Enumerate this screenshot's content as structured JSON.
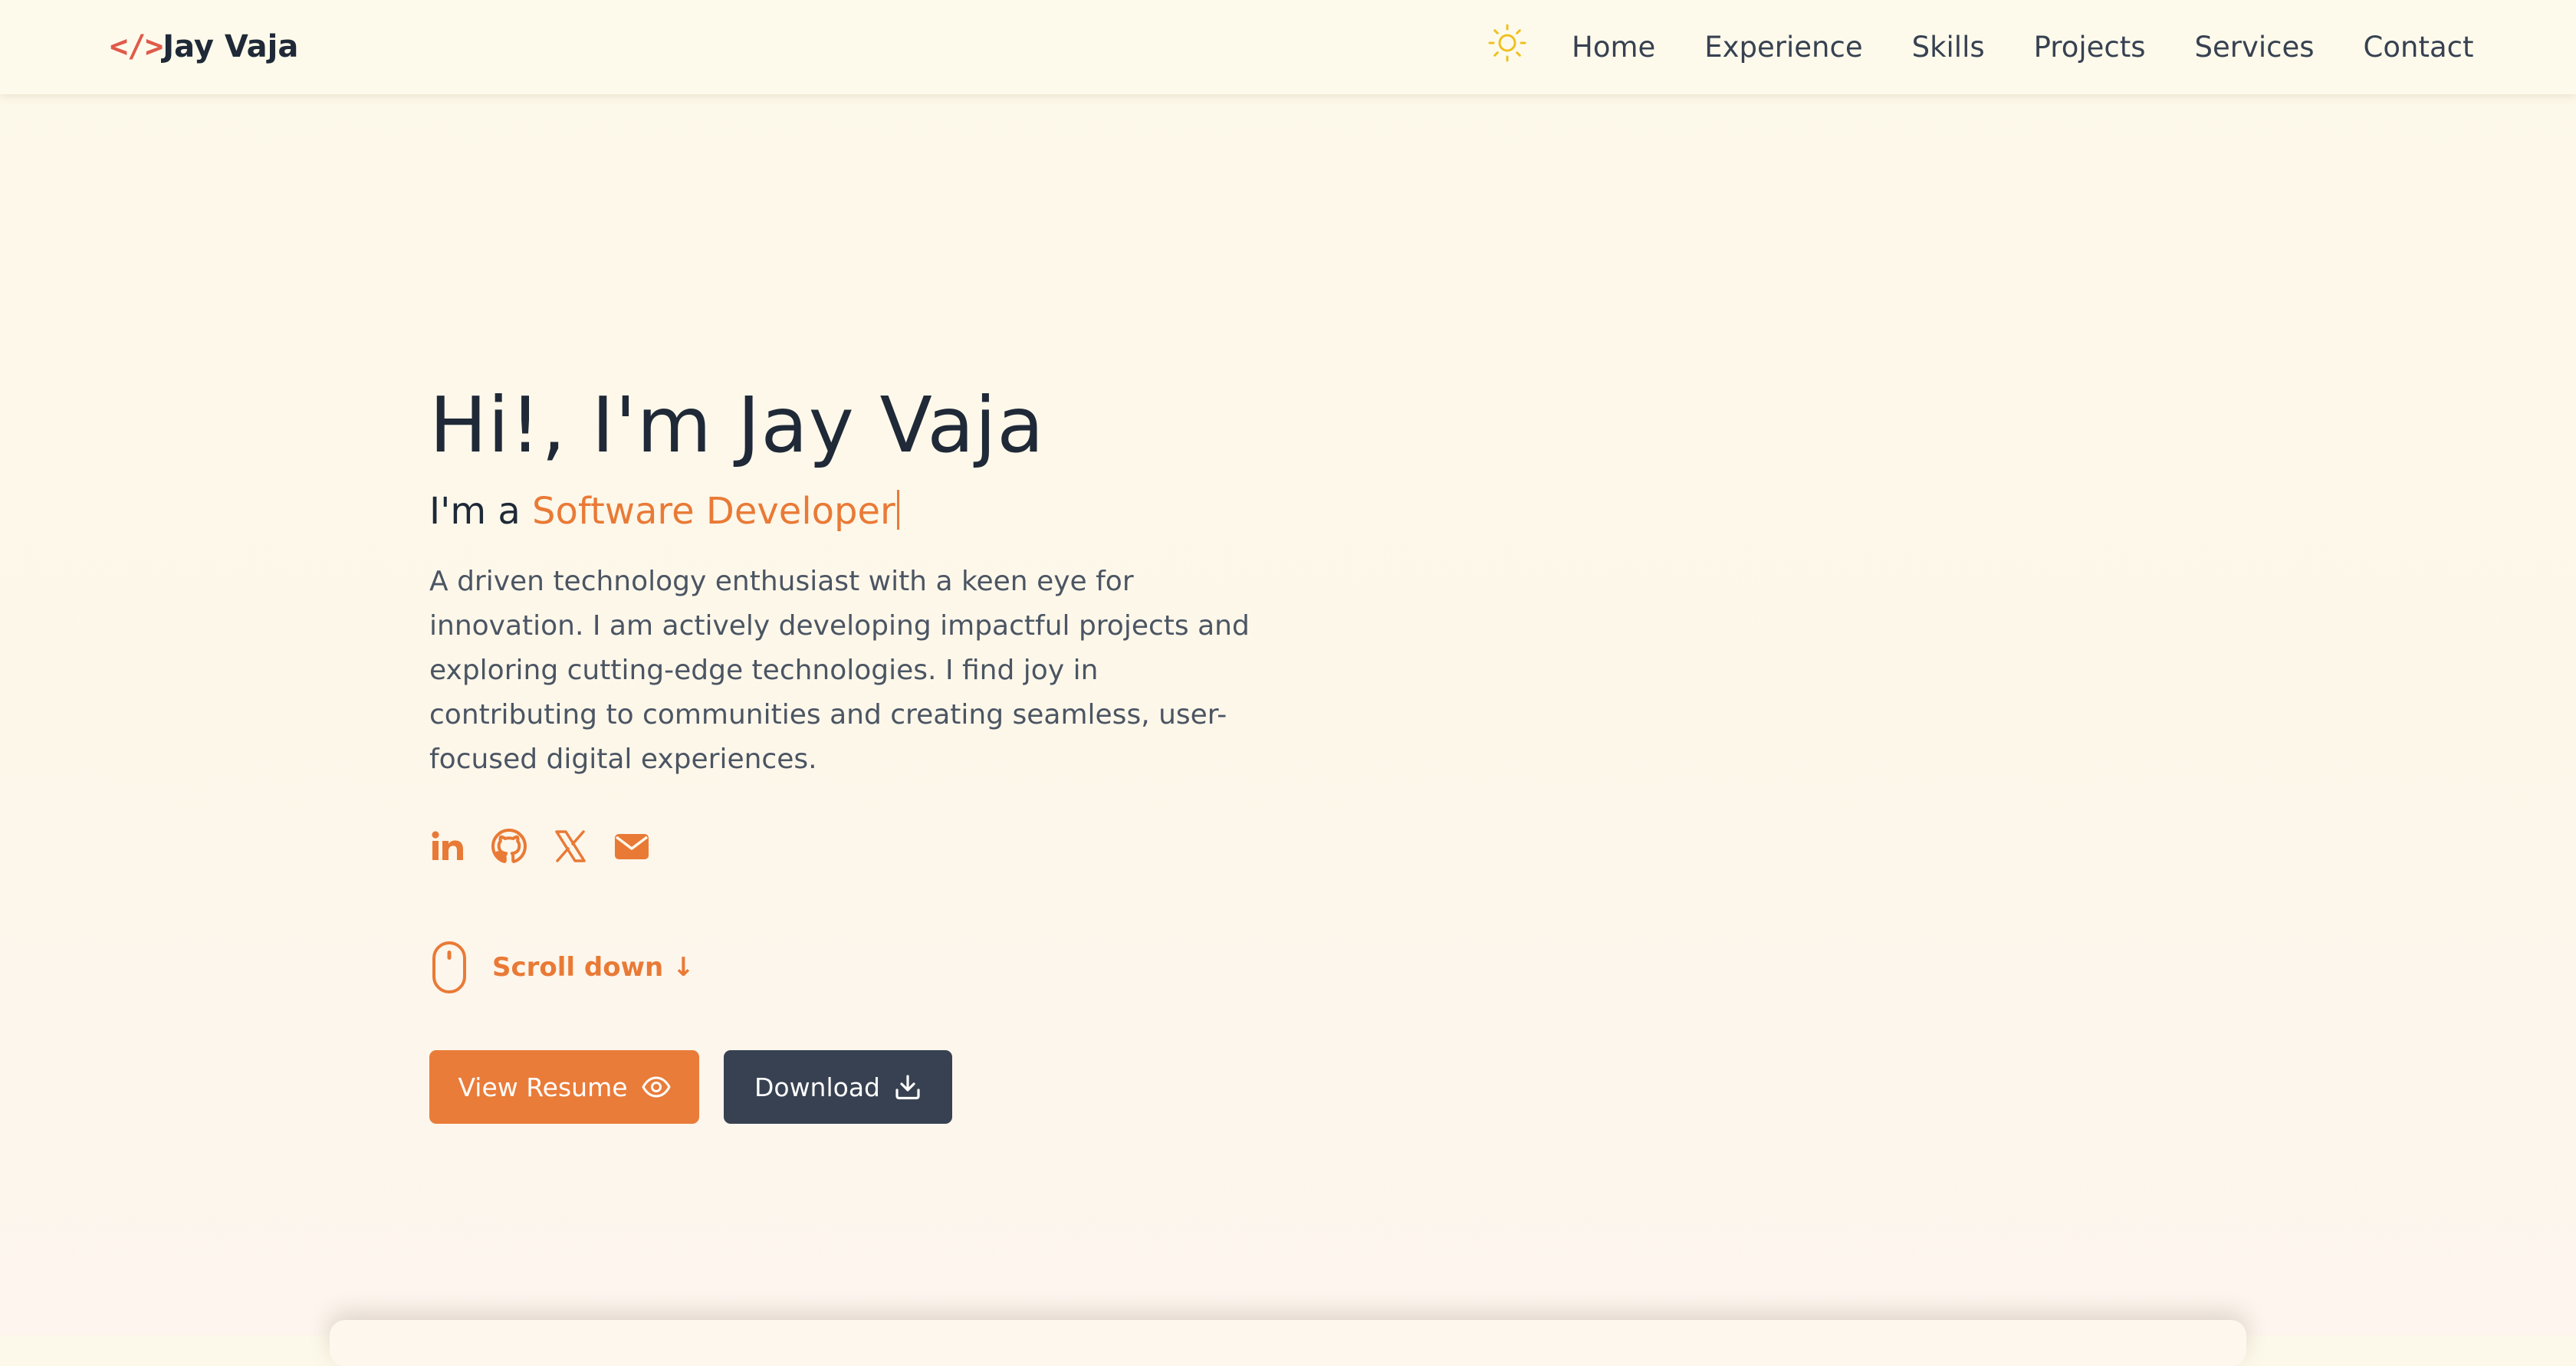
{
  "brand": {
    "mark": "</>",
    "name": "Jay Vaja",
    "mark_color": "#e05a4a"
  },
  "nav": {
    "theme_icon": "sun-icon",
    "links": [
      {
        "label": "Home"
      },
      {
        "label": "Experience"
      },
      {
        "label": "Skills"
      },
      {
        "label": "Projects"
      },
      {
        "label": "Services"
      },
      {
        "label": "Contact"
      }
    ]
  },
  "hero": {
    "greeting": "Hi!, I'm Jay Vaja",
    "subtitle_prefix": "I'm a ",
    "role": "Software Developer",
    "description": "A driven technology enthusiast with a keen eye for innovation. I am actively developing impactful projects and exploring cutting-edge technologies. I find joy in contributing to communities and creating seamless, user-focused digital experiences.",
    "socials": [
      {
        "icon": "linkedin-icon"
      },
      {
        "icon": "github-icon"
      },
      {
        "icon": "x-twitter-icon"
      },
      {
        "icon": "email-icon"
      }
    ],
    "scroll_label": "Scroll down ↓",
    "buttons": {
      "view_resume": "View Resume",
      "download": "Download"
    }
  },
  "colors": {
    "accent": "#e97a36",
    "dark_button": "#374151",
    "text": "#1f2937",
    "sun": "#f0c020"
  }
}
